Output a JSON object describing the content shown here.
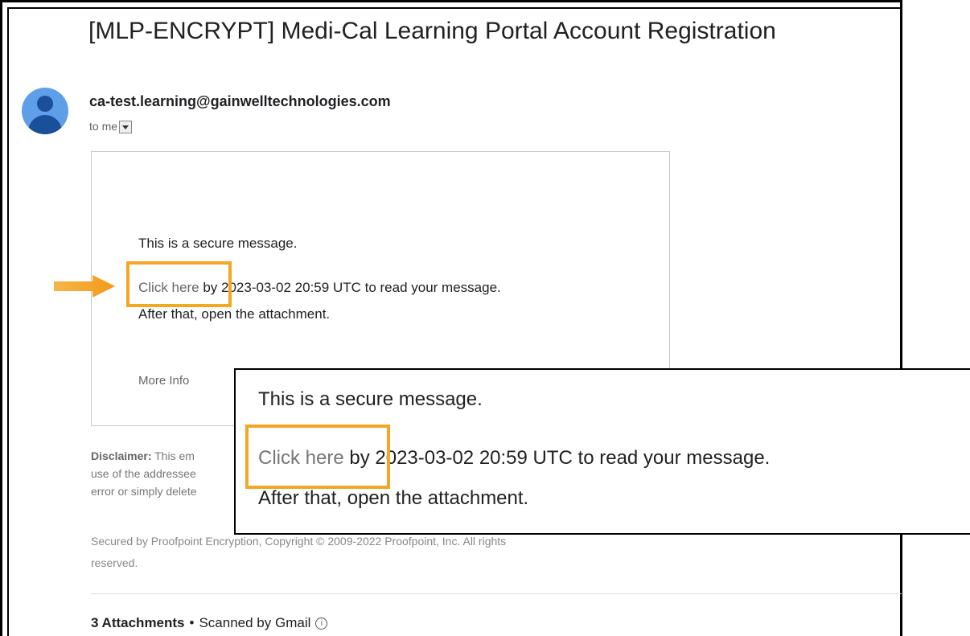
{
  "email": {
    "subject": "[MLP-ENCRYPT] Medi-Cal Learning Portal Account Registration",
    "sender": "ca-test.learning@gainwelltechnologies.com",
    "recipient_label": "to me",
    "avatar_icon": "person-avatar-icon"
  },
  "message": {
    "secure_line": "This is a secure message.",
    "link_text": "Click here",
    "link_suffix": " by 2023-03-02 20:59 UTC to read your message.",
    "attachment_line": "After that, open the attachment.",
    "more_info": "More Info"
  },
  "disclaimer": {
    "label": "Disclaimer:",
    "line1": "This em",
    "line2": "use of the addressee",
    "line3": "error or simply delete"
  },
  "footer": {
    "secured_line1": "Secured by Proofpoint Encryption, Copyright © 2009-2022 Proofpoint, Inc. All rights",
    "secured_line2": "reserved."
  },
  "attachments": {
    "count_label": "3 Attachments",
    "separator": "•",
    "scanned": "Scanned by Gmail",
    "info_glyph": "i"
  },
  "zoom": {
    "secure_line": "This is a secure message.",
    "link_text": "Click here",
    "link_suffix": " by 2023-03-02 20:59 UTC to read your message.",
    "attachment_line": "After that, open the attachment."
  },
  "colors": {
    "highlight": "#f5a623",
    "avatar_bg": "#5f9ee8",
    "avatar_fg": "#1a4f99"
  }
}
